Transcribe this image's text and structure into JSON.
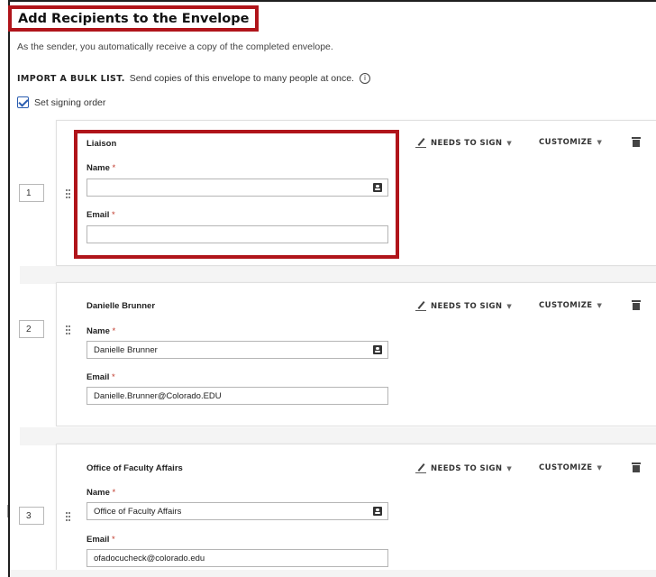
{
  "page": {
    "title": "Add Recipients to the Envelope",
    "subtitle": "As the sender, you automatically receive a copy of the completed envelope.",
    "bulk_strong": "IMPORT A BULK LIST.",
    "bulk_text": "Send copies of this envelope to many people at once.",
    "info_glyph": "i",
    "signing_order_label": "Set signing order",
    "signing_order_checked": true
  },
  "labels": {
    "name": "Name",
    "email": "Email",
    "required_mark": "*",
    "needs_to_sign": "NEEDS TO SIGN",
    "customize": "CUSTOMIZE",
    "caret": "▼"
  },
  "recipients": [
    {
      "order": "1",
      "role": "Liaison",
      "name": "",
      "email": ""
    },
    {
      "order": "2",
      "role": "Danielle Brunner",
      "name": "Danielle Brunner",
      "email": "Danielle.Brunner@Colorado.EDU"
    },
    {
      "order": "3",
      "role": "Office of Faculty Affairs",
      "name": "Office of Faculty Affairs",
      "email": "ofadocucheck@colorado.edu"
    }
  ],
  "colors": {
    "highlight": "#b0141a",
    "checkbox": "#2a5db0",
    "required": "#c0392b"
  }
}
